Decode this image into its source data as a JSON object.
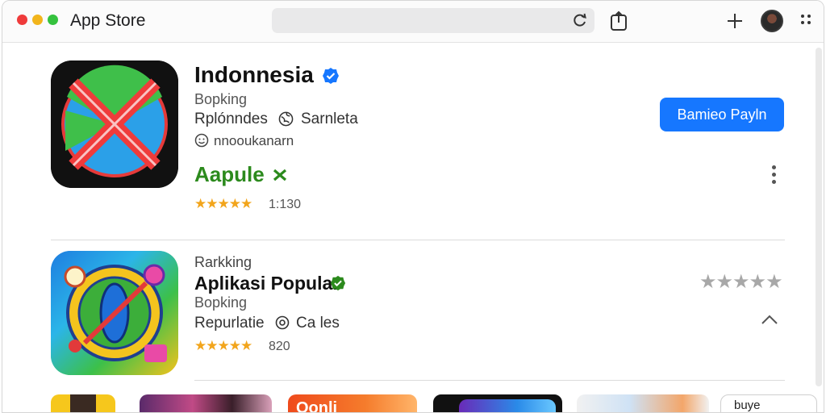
{
  "window": {
    "title": "App Store"
  },
  "toolbar": {
    "icons": [
      "reload-icon",
      "share-icon",
      "plus-icon",
      "avatar",
      "more-icon"
    ]
  },
  "apps": [
    {
      "name": "Indonnesia",
      "verified": true,
      "subtitle": "Bopking",
      "developer": "Rplónndes",
      "category": "Sarnleta",
      "meta": "nnooukanarn",
      "price": "Aapule",
      "stars": "★★★★★",
      "rating_count": "1:130",
      "action_label": "Bamieo Payln"
    },
    {
      "rank": "Rarkking",
      "name": "Aplikasi Popular",
      "verified": true,
      "subtitle": "Bopking",
      "developer": "Repurlatie",
      "category": "Ca les",
      "stars": "★★★★★",
      "rating_count": "820",
      "grey_stars": "★★★★★"
    }
  ],
  "featured": [
    {
      "label": ""
    },
    {
      "label": ""
    },
    {
      "label": "Oonli"
    },
    {
      "label": ""
    },
    {
      "label": ""
    },
    {
      "label": "buye"
    }
  ],
  "colors": {
    "accent": "#1677ff",
    "price": "#2c8a1d",
    "stars": "#f2a51c",
    "verified_blue": "#1677ff",
    "verified_green": "#2c8a1d"
  }
}
